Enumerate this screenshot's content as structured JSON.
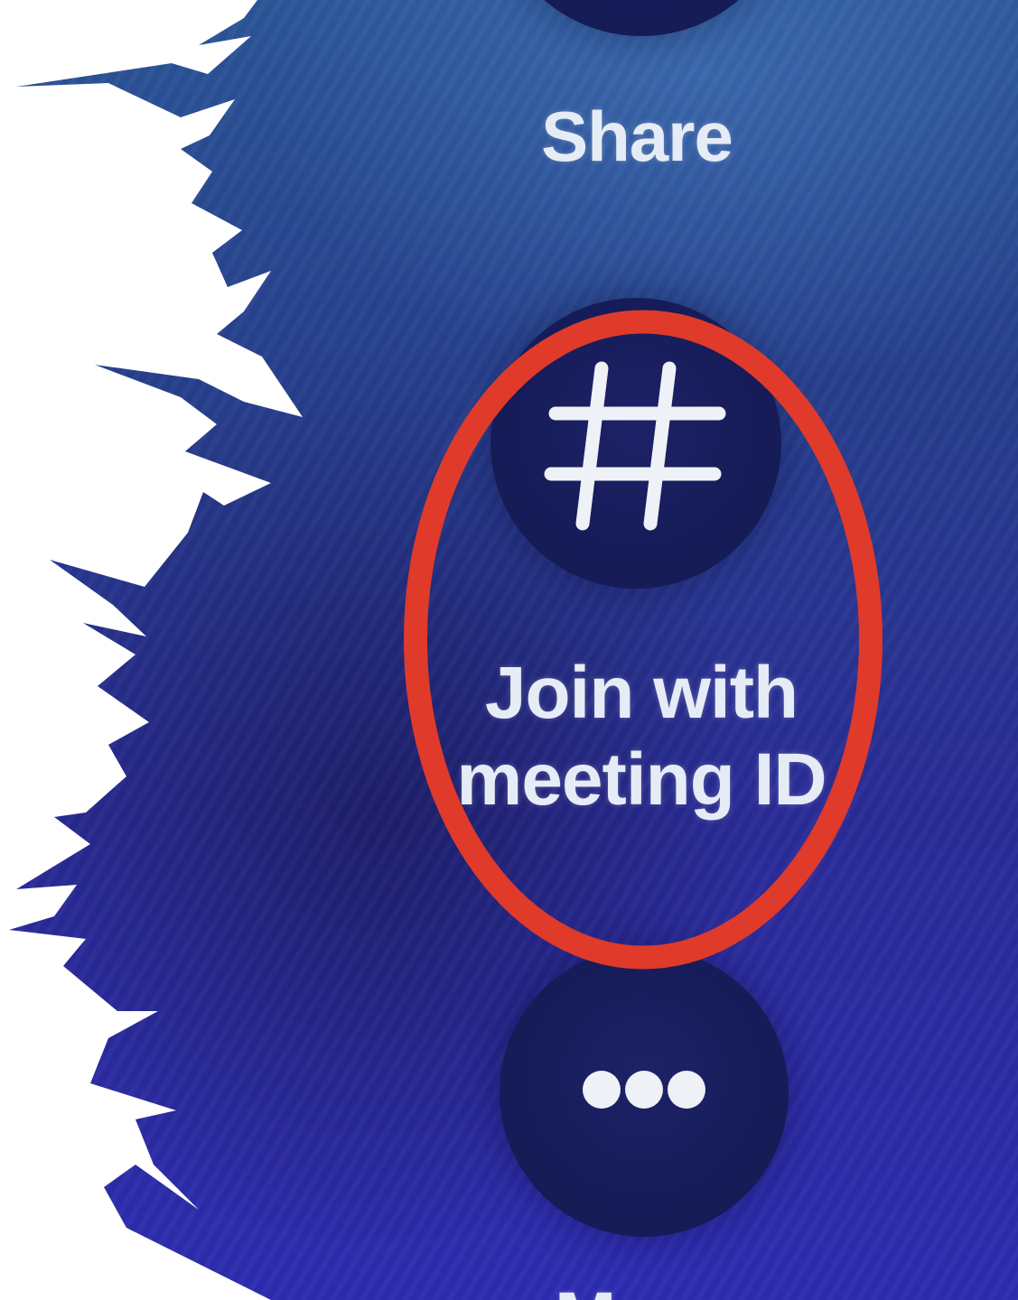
{
  "actions": {
    "share": {
      "label": "Share",
      "icon": "share-icon"
    },
    "join_meeting_id": {
      "label": "Join with\nmeeting ID",
      "icon": "hash-icon"
    },
    "more": {
      "label": "More",
      "icon": "more-dots-icon"
    }
  },
  "annotation": {
    "type": "highlight-oval",
    "target": "join_meeting_id",
    "color": "#e03a2a"
  },
  "colors": {
    "background": "#2a3a96",
    "button_fill": "#161c58",
    "label_text": "#e6ecf5"
  }
}
